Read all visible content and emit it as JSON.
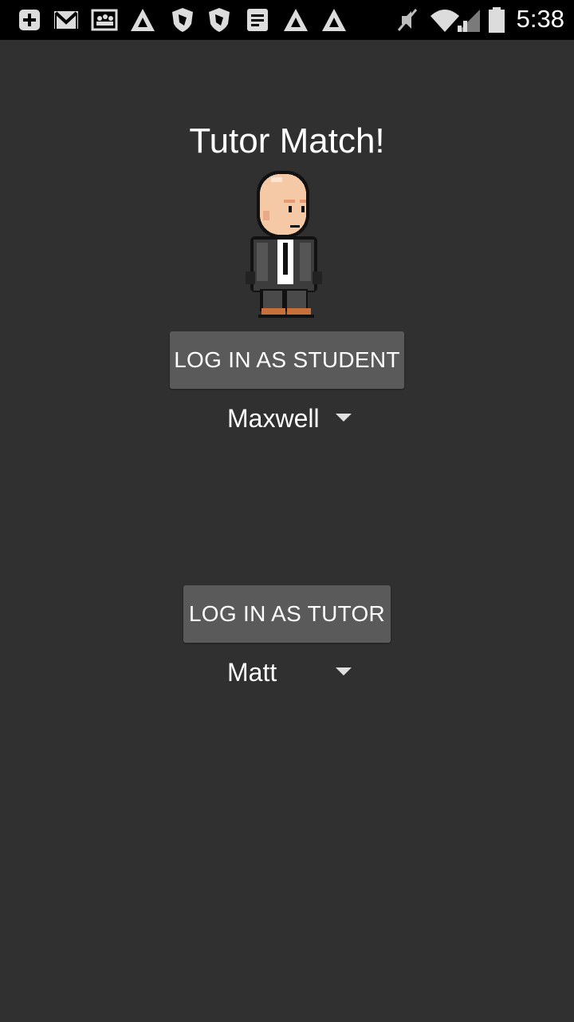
{
  "status_bar": {
    "time": "5:38",
    "left_icons": [
      "add-icon",
      "gmail-icon",
      "photo-icon",
      "alert-icon",
      "shield-icon",
      "shield-icon",
      "document-icon",
      "alert-icon",
      "alert-icon"
    ],
    "right_icons": [
      "mute-icon",
      "wifi-icon",
      "signal-icon",
      "battery-icon"
    ]
  },
  "app": {
    "title": "Tutor Match!",
    "student": {
      "button_label": "LOG IN AS STUDENT",
      "selected": "Maxwell"
    },
    "tutor": {
      "button_label": "LOG IN AS TUTOR",
      "selected": "Matt"
    }
  },
  "colors": {
    "background": "#303030",
    "button": "#5a5a5a",
    "status_bar": "#000000"
  }
}
